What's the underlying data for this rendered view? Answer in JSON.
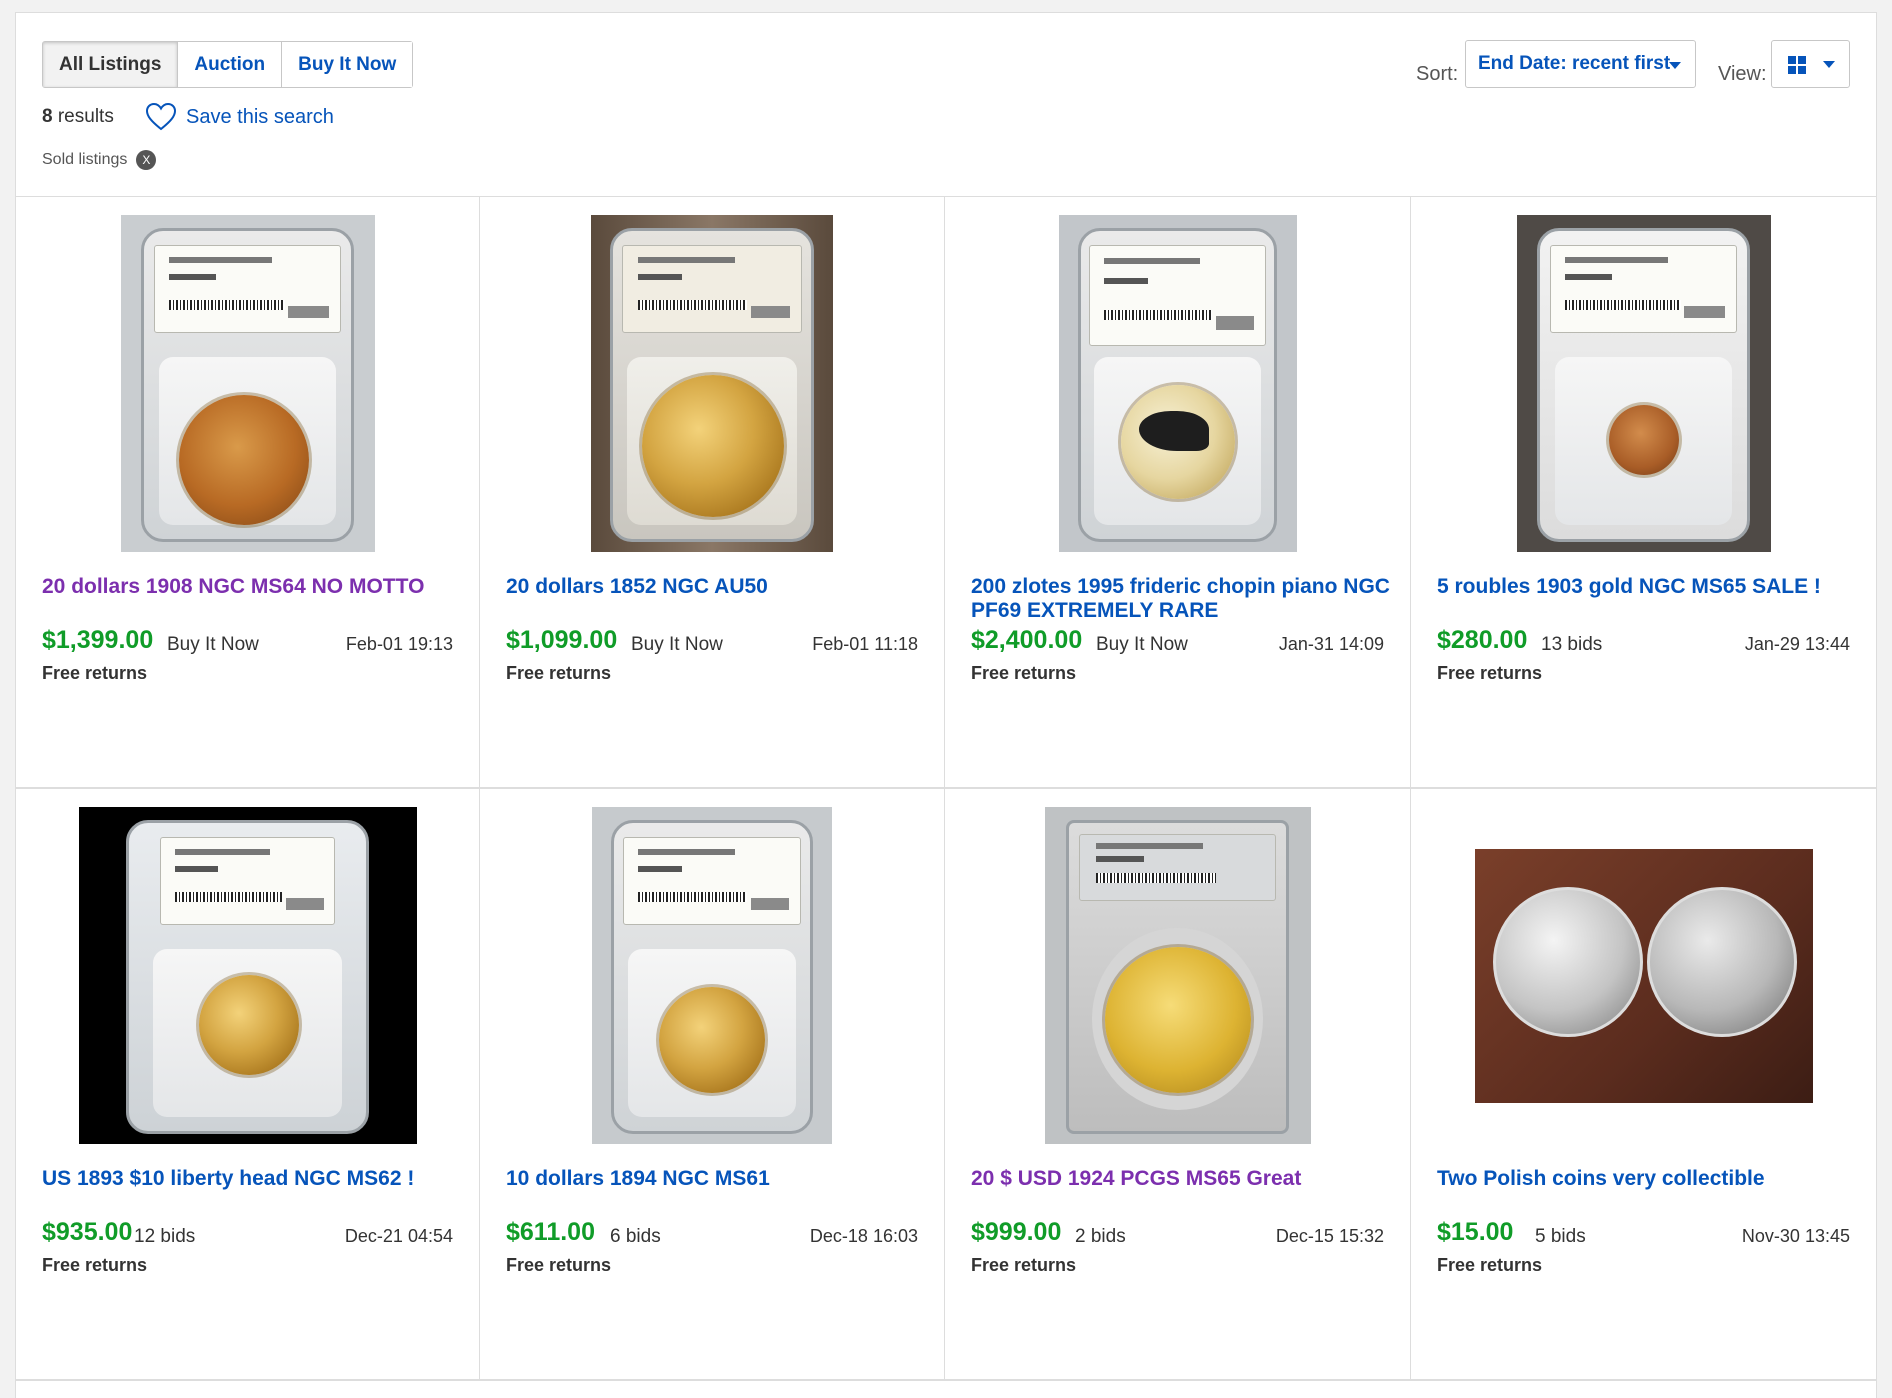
{
  "tabs": [
    {
      "label": "All Listings",
      "active": true
    },
    {
      "label": "Auction",
      "active": false
    },
    {
      "label": "Buy It Now",
      "active": false
    }
  ],
  "results": {
    "count": "8",
    "label": "results"
  },
  "save_search": {
    "label": "Save this search",
    "icon": "heart-icon"
  },
  "filter": {
    "label": "Sold listings",
    "remove": "X"
  },
  "sort": {
    "label": "Sort:",
    "value": "End Date: recent first"
  },
  "view": {
    "label": "View:",
    "icon": "grid-view-icon"
  },
  "colors": {
    "link": "#0654ba",
    "visited": "#7c2fae",
    "price": "#109c28"
  },
  "listings": [
    {
      "title": "20 dollars 1908 NGC MS64 NO MOTTO",
      "visited": true,
      "price": "$1,399.00",
      "format": "Buy It Now",
      "date": "Feb-01 19:13",
      "returns": "Free returns"
    },
    {
      "title": "20 dollars 1852 NGC AU50",
      "visited": false,
      "price": "$1,099.00",
      "format": "Buy It Now",
      "date": "Feb-01 11:18",
      "returns": "Free returns"
    },
    {
      "title": "200 zlotes 1995 frideric chopin piano NGC PF69 EXTREMELY RARE",
      "visited": false,
      "price": "$2,400.00",
      "format": "Buy It Now",
      "date": "Jan-31 14:09",
      "returns": "Free returns"
    },
    {
      "title": "5 roubles 1903 gold NGC MS65 SALE !",
      "visited": false,
      "price": "$280.00",
      "format": "13 bids",
      "date": "Jan-29 13:44",
      "returns": "Free returns"
    },
    {
      "title": "US 1893 $10 liberty head NGC MS62 !",
      "visited": false,
      "price": "$935.00",
      "format": "12 bids",
      "date": "Dec-21 04:54",
      "returns": "Free returns"
    },
    {
      "title": "10 dollars 1894 NGC MS61",
      "visited": false,
      "price": "$611.00",
      "format": "6 bids",
      "date": "Dec-18 16:03",
      "returns": "Free returns"
    },
    {
      "title": "20 $ USD 1924 PCGS MS65 Great",
      "visited": true,
      "price": "$999.00",
      "format": "2 bids",
      "date": "Dec-15 15:32",
      "returns": "Free returns"
    },
    {
      "title": "Two Polish coins very collectible",
      "visited": false,
      "price": "$15.00",
      "format": "5 bids",
      "date": "Nov-30 13:45",
      "returns": "Free returns"
    }
  ]
}
